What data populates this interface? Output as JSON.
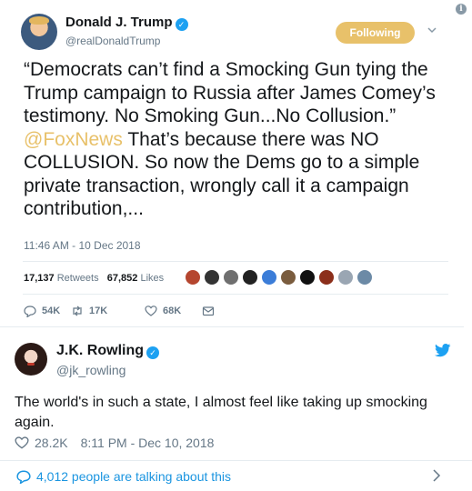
{
  "top_tweet": {
    "author_name": "Donald J. Trump",
    "author_handle": "@realDonaldTrump",
    "follow_label": "Following",
    "text_before_mention": "“Democrats can’t find a Smocking Gun tying the Trump campaign to Russia after James Comey’s testimony. No Smoking Gun...No Collusion.”",
    "mention": "@FoxNews",
    "text_after_mention": "That’s because there was NO COLLUSION. So now the Dems go to a simple private transaction, wrongly call it a campaign contribution,...",
    "timestamp": "11:46 AM - 10 Dec 2018",
    "retweets_count": "17,137",
    "retweets_label": "Retweets",
    "likes_count": "67,852",
    "likes_label": "Likes",
    "reply_count": "54K",
    "retweet_count_short": "17K",
    "like_count_short": "68K",
    "accent_color": "#e8c16a"
  },
  "bottom_tweet": {
    "author_name": "J.K. Rowling",
    "author_handle": "@jk_rowling",
    "text": "The world's in such a state, I almost feel like taking up smocking again.",
    "likes": "28.2K",
    "timestamp": "8:11 PM - Dec 10, 2018",
    "talking_text": "4,012 people are talking about this",
    "link_color": "#1b95e0"
  }
}
